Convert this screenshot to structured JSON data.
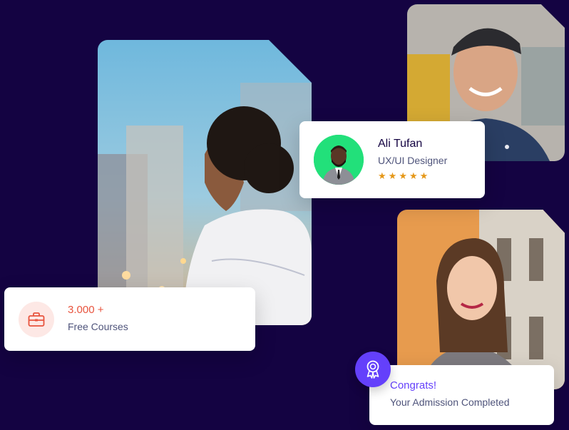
{
  "colors": {
    "background": "#140342",
    "courses_accent": "#e8543e",
    "award_accent": "#6440fb",
    "star": "#e59819",
    "avatar_bg": "#22e07a"
  },
  "photos": {
    "woman_city": "woman-with-curly-hair-city-photo",
    "man_cap": "smiling-man-backwards-cap-photo",
    "woman_smiling": "smiling-young-woman-photo"
  },
  "courses_card": {
    "icon": "briefcase-icon",
    "count": "3.000 +",
    "label": "Free Courses"
  },
  "profile_card": {
    "avatar": "profile-avatar",
    "name": "Ali Tufan",
    "role": "UX/UI Designer",
    "rating": 5
  },
  "congrats_card": {
    "icon": "award-icon",
    "title": "Congrats!",
    "text": "Your Admission Completed"
  }
}
